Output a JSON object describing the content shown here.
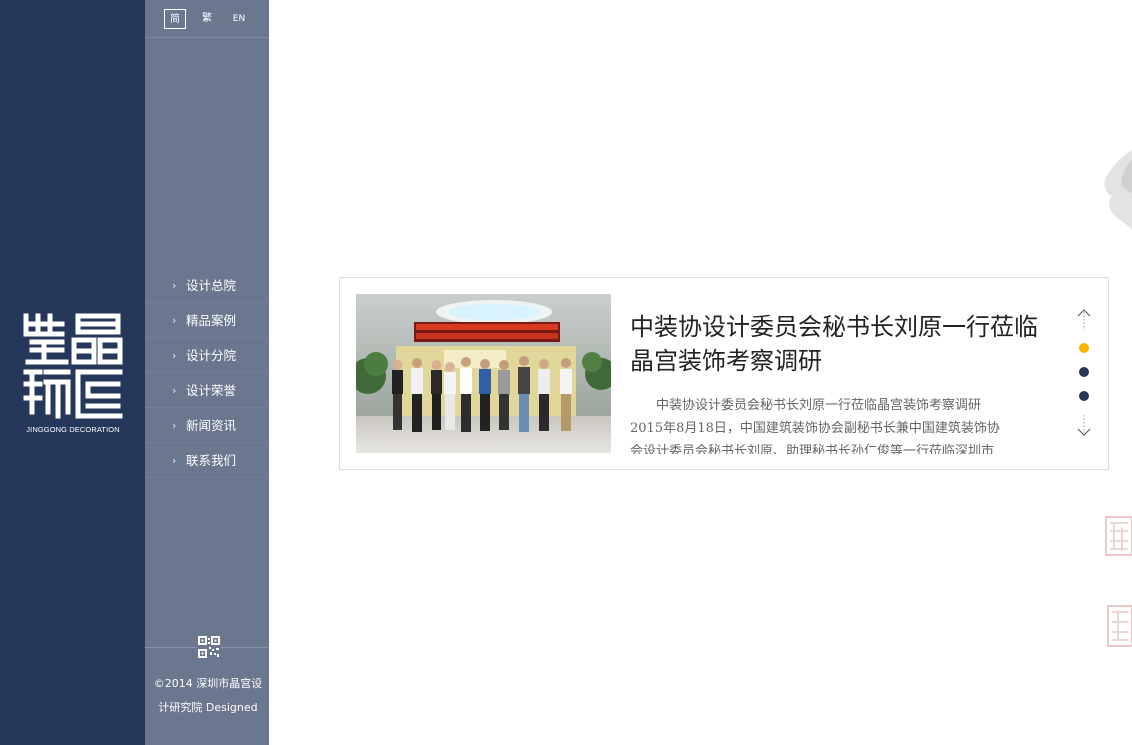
{
  "brand": {
    "logo_chars": [
      "装",
      "晶",
      "饰",
      "宫"
    ],
    "subtitle": "JINGGONG DECORATION"
  },
  "languages": [
    {
      "label": "简",
      "active": true
    },
    {
      "label": "繁",
      "active": false
    },
    {
      "label": "EN",
      "active": false
    }
  ],
  "menu": [
    {
      "label": "设计总院"
    },
    {
      "label": "精品案例"
    },
    {
      "label": "设计分院"
    },
    {
      "label": "设计荣誉"
    },
    {
      "label": "新闻资讯"
    },
    {
      "label": "联系我们"
    }
  ],
  "footer": {
    "copyright_line1": "©2014 深圳市晶宫设",
    "copyright_line2": "计研究院 Designed",
    "qr_icon": "qr-code-icon"
  },
  "news": {
    "headline": "中装协设计委员会秘书长刘原一行莅临晶宫装饰考察调研",
    "excerpt_line1": "中装协设计委员会秘书长刘原一行莅临晶宫装饰考察调研",
    "excerpt_line2": "2015年8月18日，中国建筑装饰协会副秘书长兼中国建筑装饰协",
    "excerpt_line3": "会设计委员会秘书长刘原、助理秘书长孙仁俊等一行莅临深圳市"
  },
  "pager": {
    "up_icon": "chevron-up-icon",
    "down_icon": "chevron-down-icon",
    "active_index": 1,
    "total": 3
  },
  "colors": {
    "sidebar_dark": "#25375a",
    "nav_bg": "#6a778f",
    "dot_active": "#f4b400",
    "dot_inactive": "#25375a"
  }
}
